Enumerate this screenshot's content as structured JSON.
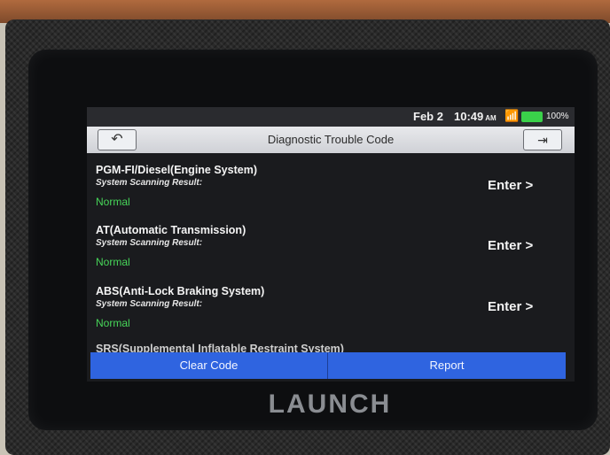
{
  "status_bar": {
    "date": "Feb 2",
    "time": "10:49",
    "ampm": "AM",
    "battery": "100%",
    "wifi_icon": "wifi-icon",
    "battery_color": "#3ad14a"
  },
  "header": {
    "title": "Diagnostic Trouble Code",
    "back_icon": "back-icon",
    "exit_icon": "exit-icon"
  },
  "systems": [
    {
      "name": "PGM-FI/Diesel(Engine System)",
      "result_label": "System Scanning Result:",
      "status": "Normal",
      "action": "Enter >"
    },
    {
      "name": "AT(Automatic Transmission)",
      "result_label": "System Scanning Result:",
      "status": "Normal",
      "action": "Enter >"
    },
    {
      "name": "ABS(Anti-Lock Braking System)",
      "result_label": "System Scanning Result:",
      "status": "Normal",
      "action": "Enter >"
    }
  ],
  "partial_item": "SRS(Supplemental Inflatable Restraint System)",
  "buttons": {
    "clear": "Clear Code",
    "report": "Report",
    "color": "#2f64e0"
  },
  "device": {
    "brand": "LAUNCH"
  },
  "colors": {
    "status_normal": "#47d659"
  }
}
